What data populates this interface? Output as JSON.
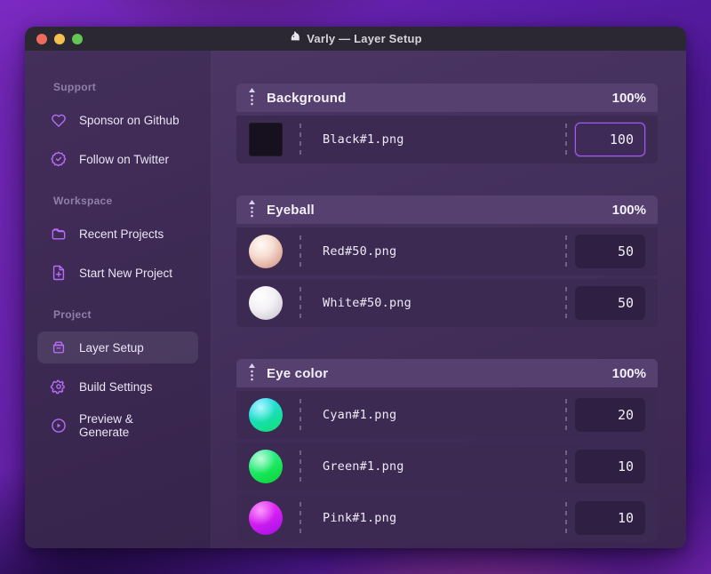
{
  "window": {
    "title": "Varly — Layer Setup",
    "title_icon": "unicorn-app-icon"
  },
  "sidebar": {
    "sections": [
      {
        "label": "Support",
        "items": [
          {
            "label": "Sponsor on Github",
            "icon": "heart-icon"
          },
          {
            "label": "Follow on Twitter",
            "icon": "badge-check-icon"
          }
        ]
      },
      {
        "label": "Workspace",
        "items": [
          {
            "label": "Recent Projects",
            "icon": "folder-icon"
          },
          {
            "label": "Start New Project",
            "icon": "file-plus-icon"
          }
        ]
      },
      {
        "label": "Project",
        "items": [
          {
            "label": "Layer Setup",
            "icon": "archive-box-icon",
            "selected": true
          },
          {
            "label": "Build Settings",
            "icon": "gear-icon"
          },
          {
            "label": "Preview & Generate",
            "icon": "play-circle-icon"
          }
        ]
      }
    ]
  },
  "layers": {
    "groups": [
      {
        "name": "Background",
        "weight": "100%",
        "items": [
          {
            "file": "Black#1.png",
            "value": "100",
            "thumb": "black-square",
            "focused": true
          }
        ]
      },
      {
        "name": "Eyeball",
        "weight": "100%",
        "items": [
          {
            "file": "Red#50.png",
            "value": "50",
            "thumb": "red-sphere"
          },
          {
            "file": "White#50.png",
            "value": "50",
            "thumb": "white-sphere"
          }
        ]
      },
      {
        "name": "Eye color",
        "weight": "100%",
        "items": [
          {
            "file": "Cyan#1.png",
            "value": "20",
            "thumb": "cyan-sphere"
          },
          {
            "file": "Green#1.png",
            "value": "10",
            "thumb": "green-sphere"
          },
          {
            "file": "Pink#1.png",
            "value": "10",
            "thumb": "pink-sphere"
          }
        ]
      }
    ]
  },
  "colors": {
    "accent": "#a55bf3",
    "icon": "#b56cf8",
    "group_header": "#55406f",
    "row_bg": "#3c2a52",
    "titlebar": "#2c2833",
    "traffic_red": "#ed6a5f",
    "traffic_yellow": "#f5bf4f",
    "traffic_green": "#62c554"
  }
}
